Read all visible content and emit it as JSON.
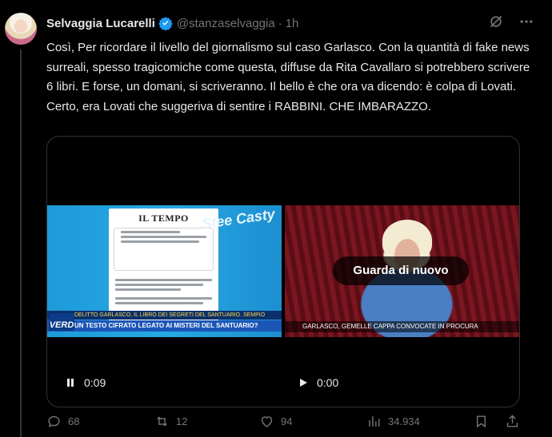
{
  "tweet": {
    "author_name": "Selvaggia Lucarelli",
    "handle": "@stanzaselvaggia",
    "separator": "·",
    "time": "1h",
    "text": "Così, Per ricordare il livello del giornalismo sul caso Garlasco. Con la quantità di fake news surreali, spesso tragicomiche come questa, diffuse da Rita Cavallaro si potrebbero scrivere 6 libri. E forse, un domani, si scriveranno. Il bello è che ora va dicendo: è colpa di Lovati. Certo, era Lovati che suggeriva di sentire i RABBINI. CHE IMBARAZZO."
  },
  "media": {
    "left": {
      "doc_title": "IL TEMPO",
      "watermark": "Stee Casty",
      "logo": "VERD",
      "banner_top": "DELITTO GARLASCO, IL LIBRO DEI SEGRETI DEL SANTUARIO. SEMPIO",
      "banner_bottom": "UN TESTO CIFRATO LEGATO AI MISTERI DEL SANTUARIO?",
      "timecode": "0:09"
    },
    "right": {
      "caption": "GARLASCO, GEMELLE CAPPA CONVOCATE IN PROCURA",
      "overlay_button": "Guarda di nuovo",
      "timecode": "0:00"
    }
  },
  "actions": {
    "replies": "68",
    "reposts": "12",
    "likes": "94",
    "views": "34.934"
  },
  "colors": {
    "background": "#000000",
    "text": "#e7e9ea",
    "muted": "#71767b",
    "verified": "#1d9bf0",
    "border": "#2f3336"
  }
}
